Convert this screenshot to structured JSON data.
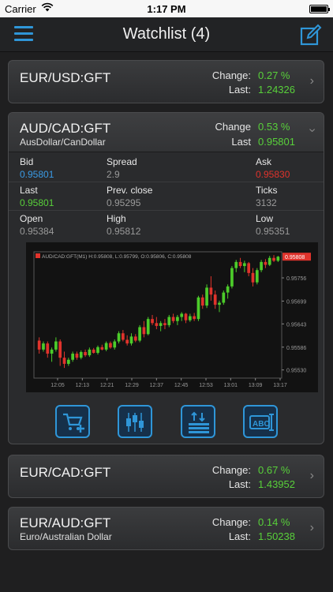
{
  "status": {
    "carrier": "Carrier",
    "time": "1:17 PM"
  },
  "nav": {
    "title": "Watchlist (4)"
  },
  "cards": [
    {
      "symbol": "EUR/USD:GFT",
      "description": "",
      "change_label": "Change:",
      "change": "0.27 %",
      "last_label": "Last:",
      "last": "1.24326"
    },
    {
      "symbol": "EUR/CAD:GFT",
      "description": "",
      "change_label": "Change:",
      "change": "0.67 %",
      "last_label": "Last:",
      "last": "1.43952"
    },
    {
      "symbol": "EUR/AUD:GFT",
      "description": "Euro/Australian Dollar",
      "change_label": "Change:",
      "change": "0.14 %",
      "last_label": "Last:",
      "last": "1.50238"
    }
  ],
  "expanded": {
    "symbol": "AUD/CAD:GFT",
    "description": "AusDollar/CanDollar",
    "change_label": "Change",
    "change": "0.53 %",
    "last_label": "Last",
    "last": "0.95801",
    "grid": [
      [
        {
          "k": "Bid",
          "v": "0.95801",
          "c": "blue"
        },
        {
          "k": "Spread",
          "v": "2.9",
          "c": ""
        },
        {
          "k": "Ask",
          "v": "0.95830",
          "c": "red"
        }
      ],
      [
        {
          "k": "Last",
          "v": "0.95801",
          "c": "green"
        },
        {
          "k": "Prev. close",
          "v": "0.95295",
          "c": ""
        },
        {
          "k": "Ticks",
          "v": "3132",
          "c": ""
        }
      ],
      [
        {
          "k": "Open",
          "v": "0.95384",
          "c": ""
        },
        {
          "k": "High",
          "v": "0.95812",
          "c": ""
        },
        {
          "k": "Low",
          "v": "0.95351",
          "c": ""
        }
      ]
    ]
  },
  "chart_data": {
    "type": "candlestick",
    "title": "AUD/CAD:GFT(M1) H:0.95808, L:0.95799, O:0.95806, C:0.95808",
    "x_ticks": [
      "12:05",
      "12:13",
      "12:21",
      "12:29",
      "12:37",
      "12:45",
      "12:53",
      "13:01",
      "13:09",
      "13:17"
    ],
    "y_ticks": [
      "0.95756",
      "0.95699",
      "0.95643",
      "0.95586",
      "0.95530"
    ],
    "price_tag": "0.95808",
    "ylim": [
      0.9551,
      0.9582
    ],
    "colors": {
      "up": "#4ccc2a",
      "down": "#e0332c"
    },
    "candles": [
      {
        "o": 0.95602,
        "h": 0.9561,
        "l": 0.9557,
        "c": 0.9558
      },
      {
        "o": 0.9558,
        "h": 0.956,
        "l": 0.95575,
        "c": 0.95595
      },
      {
        "o": 0.95595,
        "h": 0.956,
        "l": 0.9556,
        "c": 0.9557
      },
      {
        "o": 0.9557,
        "h": 0.95585,
        "l": 0.9555,
        "c": 0.9558
      },
      {
        "o": 0.9558,
        "h": 0.9561,
        "l": 0.95575,
        "c": 0.956
      },
      {
        "o": 0.956,
        "h": 0.95605,
        "l": 0.9554,
        "c": 0.9556
      },
      {
        "o": 0.9556,
        "h": 0.95575,
        "l": 0.95535,
        "c": 0.95545
      },
      {
        "o": 0.95545,
        "h": 0.9556,
        "l": 0.9554,
        "c": 0.95555
      },
      {
        "o": 0.95555,
        "h": 0.95575,
        "l": 0.9555,
        "c": 0.9557
      },
      {
        "o": 0.9557,
        "h": 0.95575,
        "l": 0.95555,
        "c": 0.9556
      },
      {
        "o": 0.9556,
        "h": 0.95578,
        "l": 0.95556,
        "c": 0.95574
      },
      {
        "o": 0.95574,
        "h": 0.9558,
        "l": 0.95562,
        "c": 0.95566
      },
      {
        "o": 0.95566,
        "h": 0.95585,
        "l": 0.95562,
        "c": 0.9558
      },
      {
        "o": 0.9558,
        "h": 0.95584,
        "l": 0.9557,
        "c": 0.95572
      },
      {
        "o": 0.95572,
        "h": 0.9559,
        "l": 0.95568,
        "c": 0.95586
      },
      {
        "o": 0.95586,
        "h": 0.95592,
        "l": 0.95578,
        "c": 0.9558
      },
      {
        "o": 0.9558,
        "h": 0.956,
        "l": 0.95576,
        "c": 0.95596
      },
      {
        "o": 0.95596,
        "h": 0.956,
        "l": 0.95582,
        "c": 0.95585
      },
      {
        "o": 0.95585,
        "h": 0.95605,
        "l": 0.9558,
        "c": 0.956
      },
      {
        "o": 0.956,
        "h": 0.95625,
        "l": 0.95595,
        "c": 0.9562
      },
      {
        "o": 0.9562,
        "h": 0.95628,
        "l": 0.956,
        "c": 0.95604
      },
      {
        "o": 0.95604,
        "h": 0.95615,
        "l": 0.9559,
        "c": 0.95595
      },
      {
        "o": 0.95595,
        "h": 0.9562,
        "l": 0.9559,
        "c": 0.95612
      },
      {
        "o": 0.95612,
        "h": 0.95618,
        "l": 0.95598,
        "c": 0.95602
      },
      {
        "o": 0.95602,
        "h": 0.9564,
        "l": 0.95598,
        "c": 0.95635
      },
      {
        "o": 0.95635,
        "h": 0.9565,
        "l": 0.9561,
        "c": 0.95618
      },
      {
        "o": 0.95618,
        "h": 0.9566,
        "l": 0.95615,
        "c": 0.95655
      },
      {
        "o": 0.95655,
        "h": 0.95665,
        "l": 0.9564,
        "c": 0.95645
      },
      {
        "o": 0.95645,
        "h": 0.9566,
        "l": 0.9563,
        "c": 0.95638
      },
      {
        "o": 0.95638,
        "h": 0.9565,
        "l": 0.95625,
        "c": 0.95645
      },
      {
        "o": 0.95645,
        "h": 0.95655,
        "l": 0.9563,
        "c": 0.9564
      },
      {
        "o": 0.9564,
        "h": 0.95665,
        "l": 0.95635,
        "c": 0.9566
      },
      {
        "o": 0.9566,
        "h": 0.95668,
        "l": 0.95645,
        "c": 0.9565
      },
      {
        "o": 0.9565,
        "h": 0.95665,
        "l": 0.9564,
        "c": 0.9566
      },
      {
        "o": 0.9566,
        "h": 0.95672,
        "l": 0.9565,
        "c": 0.95668
      },
      {
        "o": 0.95668,
        "h": 0.9567,
        "l": 0.95645,
        "c": 0.95652
      },
      {
        "o": 0.95652,
        "h": 0.95668,
        "l": 0.95648,
        "c": 0.95662
      },
      {
        "o": 0.95662,
        "h": 0.9567,
        "l": 0.9565,
        "c": 0.95655
      },
      {
        "o": 0.95655,
        "h": 0.95712,
        "l": 0.9565,
        "c": 0.95708
      },
      {
        "o": 0.95708,
        "h": 0.95715,
        "l": 0.9568,
        "c": 0.95688
      },
      {
        "o": 0.95688,
        "h": 0.9574,
        "l": 0.95682,
        "c": 0.95732
      },
      {
        "o": 0.95732,
        "h": 0.9576,
        "l": 0.957,
        "c": 0.95715
      },
      {
        "o": 0.95715,
        "h": 0.95725,
        "l": 0.9568,
        "c": 0.9569
      },
      {
        "o": 0.9569,
        "h": 0.957,
        "l": 0.95672,
        "c": 0.95695
      },
      {
        "o": 0.95695,
        "h": 0.95725,
        "l": 0.9569,
        "c": 0.9572
      },
      {
        "o": 0.9572,
        "h": 0.9574,
        "l": 0.95705,
        "c": 0.95735
      },
      {
        "o": 0.95735,
        "h": 0.95785,
        "l": 0.9573,
        "c": 0.9578
      },
      {
        "o": 0.9578,
        "h": 0.958,
        "l": 0.9577,
        "c": 0.95795
      },
      {
        "o": 0.95795,
        "h": 0.95805,
        "l": 0.9578,
        "c": 0.95785
      },
      {
        "o": 0.95785,
        "h": 0.95798,
        "l": 0.9577,
        "c": 0.95792
      },
      {
        "o": 0.95792,
        "h": 0.95795,
        "l": 0.9576,
        "c": 0.95768
      },
      {
        "o": 0.95768,
        "h": 0.9578,
        "l": 0.95735,
        "c": 0.95745
      },
      {
        "o": 0.95745,
        "h": 0.9578,
        "l": 0.9574,
        "c": 0.95775
      },
      {
        "o": 0.95775,
        "h": 0.958,
        "l": 0.9577,
        "c": 0.95795
      },
      {
        "o": 0.95795,
        "h": 0.95802,
        "l": 0.9578,
        "c": 0.95788
      },
      {
        "o": 0.95788,
        "h": 0.9581,
        "l": 0.95785,
        "c": 0.95805
      },
      {
        "o": 0.95805,
        "h": 0.95812,
        "l": 0.95795,
        "c": 0.95798
      },
      {
        "o": 0.95798,
        "h": 0.9581,
        "l": 0.95795,
        "c": 0.95808
      }
    ]
  },
  "toolbar": {
    "icons": [
      "cart-add-icon",
      "candlestick-chart-icon",
      "sort-orders-icon",
      "text-label-icon"
    ],
    "label_icon_text": "ABC"
  }
}
